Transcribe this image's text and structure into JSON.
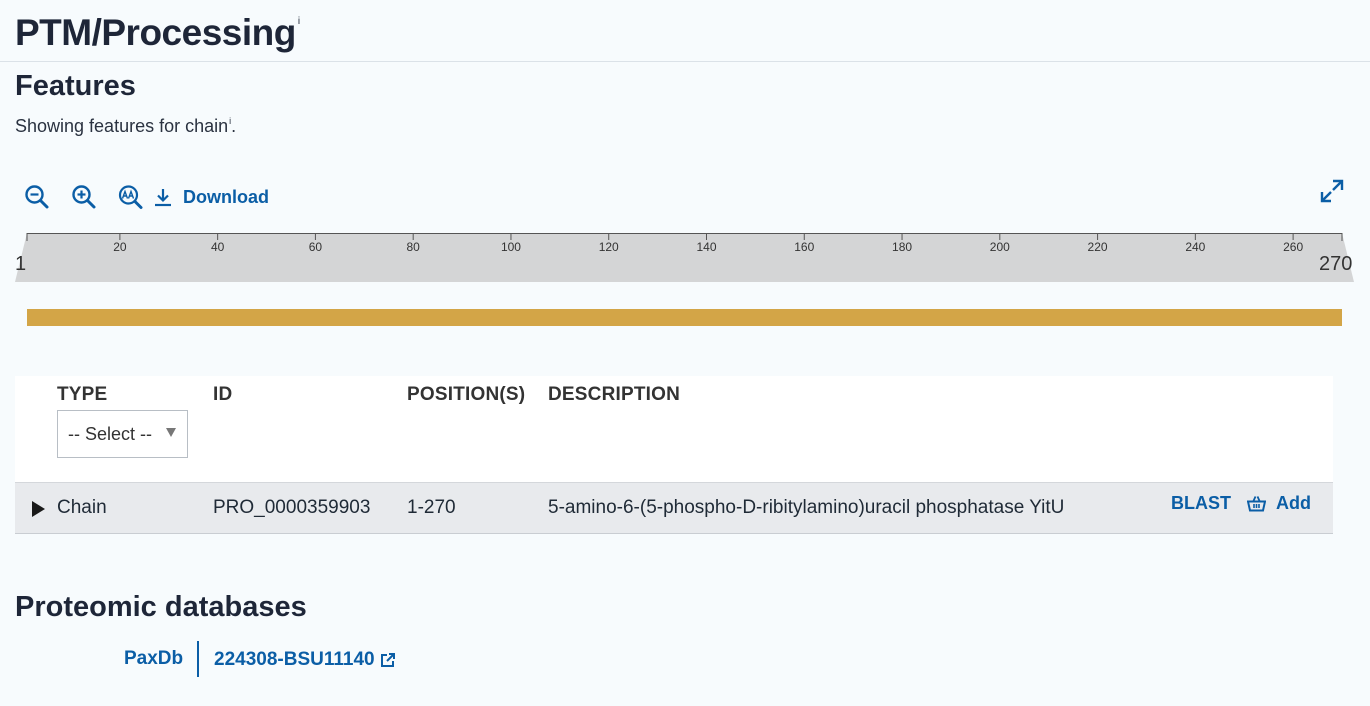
{
  "page": {
    "title": "PTM/Processing",
    "title_info_marker": "i"
  },
  "features": {
    "title": "Features",
    "subtitle": "Showing features for chain",
    "subtitle_info_marker": "i",
    "subtitle_period": "."
  },
  "toolbar": {
    "zoom_out_icon": "zoom-out-icon",
    "zoom_in_icon": "zoom-in-icon",
    "zoom_text_icon": "zoom-text-icon",
    "download_label": "Download",
    "fullscreen_icon": "fullscreen-icon"
  },
  "ruler": {
    "start": "1",
    "end": "270",
    "ticks": [
      "20",
      "40",
      "60",
      "80",
      "100",
      "120",
      "140",
      "160",
      "180",
      "200",
      "220",
      "240",
      "260"
    ]
  },
  "table": {
    "headers": {
      "type": "TYPE",
      "id": "ID",
      "positions": "POSITION(S)",
      "description": "DESCRIPTION"
    },
    "type_filter": "-- Select --",
    "rows": [
      {
        "type": "Chain",
        "id": "PRO_0000359903",
        "positions": "1-270",
        "description": "5-amino-6-(5-phospho-D-ribitylamino)uracil phosphatase YitU",
        "blast_label": "BLAST",
        "add_label": "Add"
      }
    ]
  },
  "proteomic": {
    "title": "Proteomic databases",
    "databases": [
      {
        "name": "PaxDb",
        "value": "224308-BSU11140"
      }
    ]
  },
  "colors": {
    "link": "#0b5ea6",
    "chain_track": "#d3a547",
    "ruler": "#d4d5d6",
    "row_bg": "#e8eaed"
  }
}
